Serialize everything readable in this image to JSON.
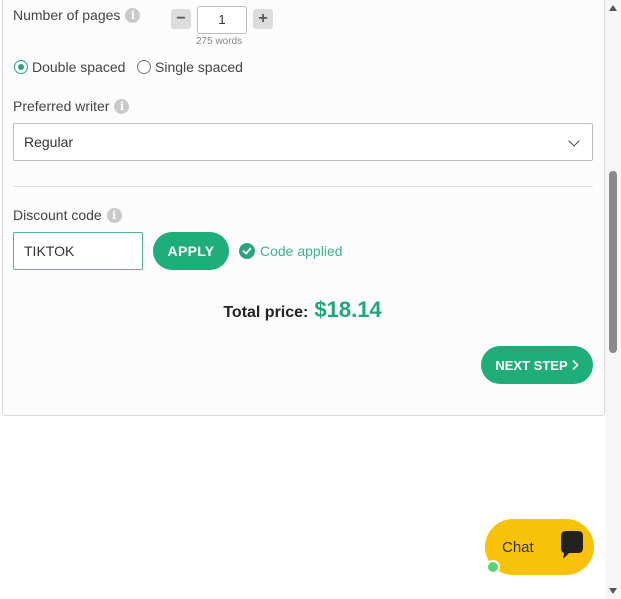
{
  "pages": {
    "label": "Number of pages",
    "value": "1",
    "words_note": "275 words",
    "decrement": "−",
    "increment": "+"
  },
  "spacing": {
    "options": [
      {
        "label": "Double spaced",
        "selected": true
      },
      {
        "label": "Single spaced",
        "selected": false
      }
    ]
  },
  "writer": {
    "label": "Preferred writer",
    "selected": "Regular"
  },
  "discount": {
    "label": "Discount code",
    "value": "TIKTOK",
    "apply_label": "APPLY",
    "status": "Code applied"
  },
  "total": {
    "label": "Total price:",
    "value": "$18.14"
  },
  "next_label": "NEXT STEP",
  "chat": {
    "label": "Chat",
    "color": "#f9c20a"
  },
  "info_glyph": "i",
  "colors": {
    "accent": "#1fad79",
    "price": "#1fa877"
  }
}
